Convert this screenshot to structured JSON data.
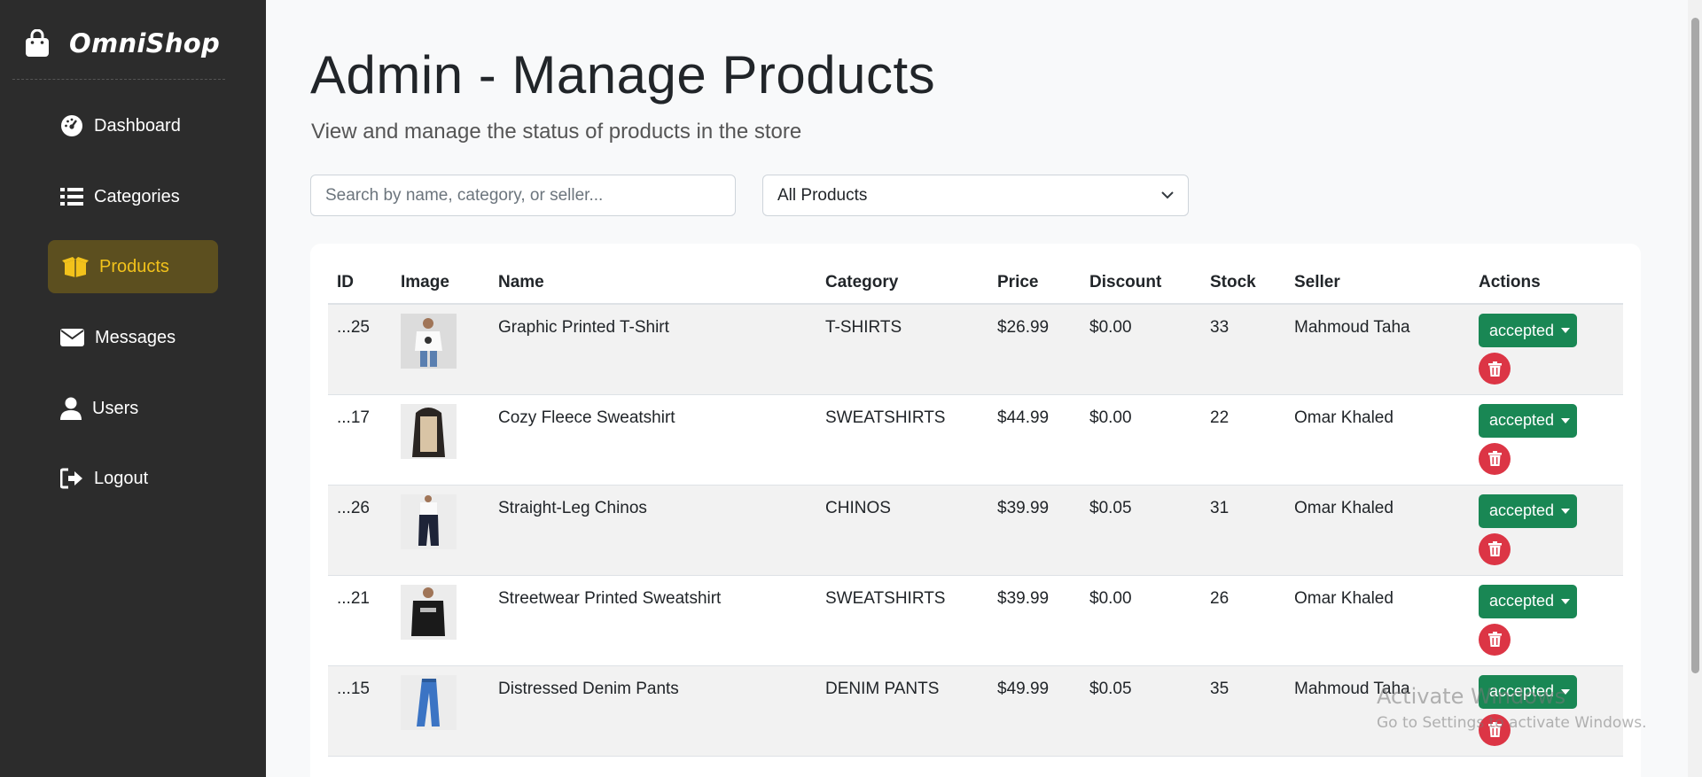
{
  "app": {
    "name": "OmniShop"
  },
  "sidebar": {
    "items": [
      {
        "label": "Dashboard",
        "icon": "gauge-icon"
      },
      {
        "label": "Categories",
        "icon": "list-icon"
      },
      {
        "label": "Products",
        "icon": "box-icon",
        "active": true
      },
      {
        "label": "Messages",
        "icon": "envelope-icon"
      },
      {
        "label": "Users",
        "icon": "user-icon"
      },
      {
        "label": "Logout",
        "icon": "logout-icon"
      }
    ]
  },
  "header": {
    "title": "Admin - Manage Products",
    "subtitle": "View and manage the status of products in the store"
  },
  "filters": {
    "search_placeholder": "Search by name, category, or seller...",
    "filter_selected": "All Products"
  },
  "table": {
    "columns": [
      "ID",
      "Image",
      "Name",
      "Category",
      "Price",
      "Discount",
      "Stock",
      "Seller",
      "Actions"
    ],
    "rows": [
      {
        "id": "...25",
        "name": "Graphic Printed T-Shirt",
        "category": "T-SHIRTS",
        "price": "$26.99",
        "discount": "$0.00",
        "stock": "33",
        "seller": "Mahmoud Taha",
        "status": "accepted"
      },
      {
        "id": "...17",
        "name": "Cozy Fleece Sweatshirt",
        "category": "SWEATSHIRTS",
        "price": "$44.99",
        "discount": "$0.00",
        "stock": "22",
        "seller": "Omar Khaled",
        "status": "accepted"
      },
      {
        "id": "...26",
        "name": "Straight-Leg Chinos",
        "category": "CHINOS",
        "price": "$39.99",
        "discount": "$0.05",
        "stock": "31",
        "seller": "Omar Khaled",
        "status": "accepted"
      },
      {
        "id": "...21",
        "name": "Streetwear Printed Sweatshirt",
        "category": "SWEATSHIRTS",
        "price": "$39.99",
        "discount": "$0.00",
        "stock": "26",
        "seller": "Omar Khaled",
        "status": "accepted"
      },
      {
        "id": "...15",
        "name": "Distressed Denim Pants",
        "category": "DENIM PANTS",
        "price": "$49.99",
        "discount": "$0.05",
        "stock": "35",
        "seller": "Mahmoud Taha",
        "status": "accepted"
      }
    ]
  },
  "watermark": {
    "line1": "Activate Windows",
    "line2": "Go to Settings to activate Windows."
  },
  "colors": {
    "sidebar_bg": "#2c2c2c",
    "active_text": "#f2c21b",
    "accept_green": "#198754",
    "delete_red": "#dc3545"
  }
}
